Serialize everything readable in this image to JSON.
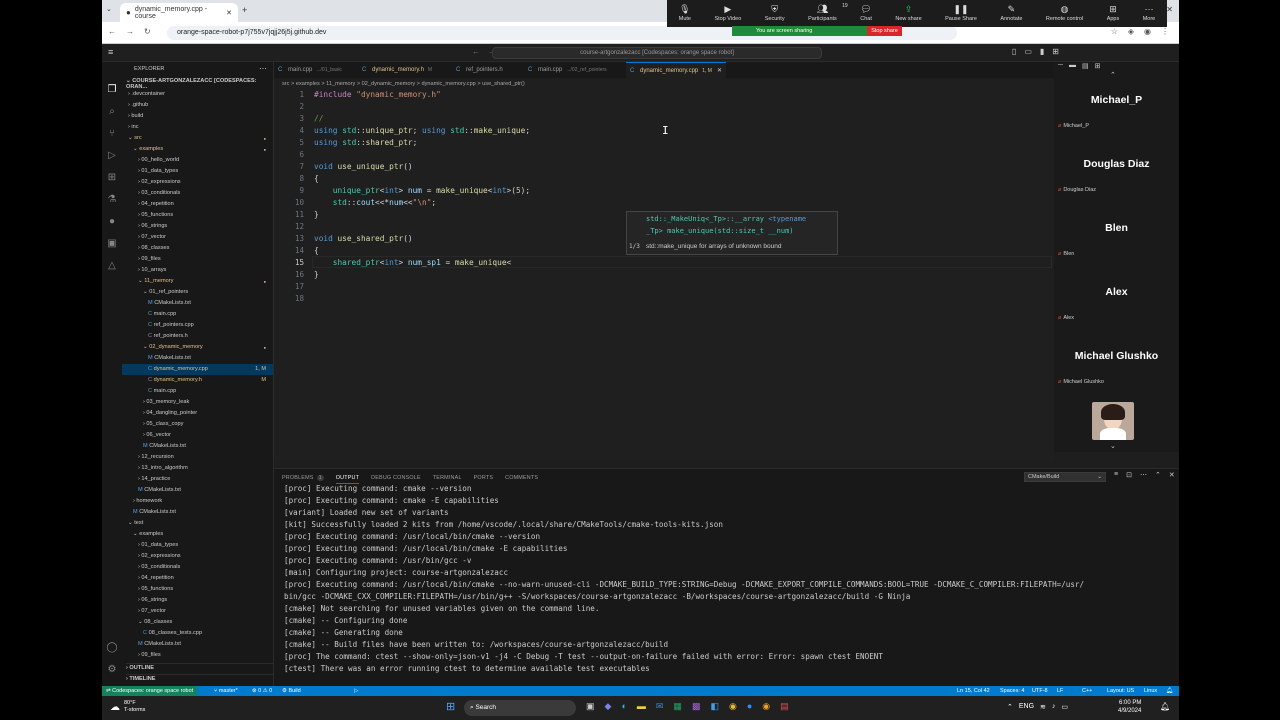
{
  "browser": {
    "tab_title": "dynamic_memory.cpp - course",
    "url": "orange-space-robot-p7j755v7jqjj26j5j.github.dev"
  },
  "zoom": {
    "buttons": [
      {
        "label": "Mute",
        "icon": "microphone-icon"
      },
      {
        "label": "Stop Video",
        "icon": "video-icon"
      },
      {
        "label": "Security",
        "icon": "shield-icon"
      },
      {
        "label": "Participants",
        "icon": "people-icon"
      },
      {
        "label": "Chat",
        "icon": "chat-icon"
      },
      {
        "label": "New share",
        "icon": "share-icon"
      },
      {
        "label": "Pause Share",
        "icon": "pause-icon"
      },
      {
        "label": "Annotate",
        "icon": "pen-icon"
      },
      {
        "label": "Remote control",
        "icon": "mouse-icon"
      },
      {
        "label": "Apps",
        "icon": "apps-icon"
      },
      {
        "label": "More",
        "icon": "more-icon"
      }
    ],
    "participants_count": "19",
    "sharing_text": "You are screen sharing",
    "stop_share": "Stop share"
  },
  "vscode": {
    "command_center": "course-artgonzalezacc [Codespaces: orange space robot]",
    "explorer_title": "EXPLORER",
    "workspace": "COURSE-ARTGONZALEZACC [CODESPACES: ORAN...",
    "tree": [
      {
        "label": ".devcontainer",
        "indent": 0,
        "kind": "folder"
      },
      {
        "label": ".github",
        "indent": 0,
        "kind": "folder"
      },
      {
        "label": "build",
        "indent": 0,
        "kind": "folder"
      },
      {
        "label": "inc",
        "indent": 0,
        "kind": "folder"
      },
      {
        "label": "src",
        "indent": 0,
        "kind": "folder-open",
        "mod": true
      },
      {
        "label": "examples",
        "indent": 1,
        "kind": "folder-open",
        "mod": true
      },
      {
        "label": "00_hello_world",
        "indent": 2,
        "kind": "folder"
      },
      {
        "label": "01_data_types",
        "indent": 2,
        "kind": "folder"
      },
      {
        "label": "02_expressions",
        "indent": 2,
        "kind": "folder"
      },
      {
        "label": "03_conditionals",
        "indent": 2,
        "kind": "folder"
      },
      {
        "label": "04_repetition",
        "indent": 2,
        "kind": "folder"
      },
      {
        "label": "05_functions",
        "indent": 2,
        "kind": "folder"
      },
      {
        "label": "06_strings",
        "indent": 2,
        "kind": "folder"
      },
      {
        "label": "07_vector",
        "indent": 2,
        "kind": "folder"
      },
      {
        "label": "08_classes",
        "indent": 2,
        "kind": "folder"
      },
      {
        "label": "09_files",
        "indent": 2,
        "kind": "folder"
      },
      {
        "label": "10_arrays",
        "indent": 2,
        "kind": "folder"
      },
      {
        "label": "11_memory",
        "indent": 2,
        "kind": "folder-open",
        "mod": true
      },
      {
        "label": "01_ref_pointers",
        "indent": 3,
        "kind": "folder-open"
      },
      {
        "label": "CMakeLists.txt",
        "indent": 4,
        "kind": "cmake"
      },
      {
        "label": "main.cpp",
        "indent": 4,
        "kind": "cpp"
      },
      {
        "label": "ref_pointers.cpp",
        "indent": 4,
        "kind": "cpp"
      },
      {
        "label": "ref_pointers.h",
        "indent": 4,
        "kind": "h"
      },
      {
        "label": "02_dynamic_memory",
        "indent": 3,
        "kind": "folder-open",
        "mod": true
      },
      {
        "label": "CMakeLists.txt",
        "indent": 4,
        "kind": "cmake"
      },
      {
        "label": "dynamic_memory.cpp",
        "indent": 4,
        "kind": "cpp",
        "selected": true,
        "badge": "1, M"
      },
      {
        "label": "dynamic_memory.h",
        "indent": 4,
        "kind": "h",
        "badge": "M"
      },
      {
        "label": "main.cpp",
        "indent": 4,
        "kind": "cpp"
      },
      {
        "label": "03_memory_leak",
        "indent": 3,
        "kind": "folder"
      },
      {
        "label": "04_dangling_pointer",
        "indent": 3,
        "kind": "folder"
      },
      {
        "label": "05_class_copy",
        "indent": 3,
        "kind": "folder"
      },
      {
        "label": "06_vector",
        "indent": 3,
        "kind": "folder"
      },
      {
        "label": "CMakeLists.txt",
        "indent": 3,
        "kind": "cmake"
      },
      {
        "label": "12_recursion",
        "indent": 2,
        "kind": "folder"
      },
      {
        "label": "13_intro_algorithm",
        "indent": 2,
        "kind": "folder"
      },
      {
        "label": "14_practice",
        "indent": 2,
        "kind": "folder"
      },
      {
        "label": "CMakeLists.txt",
        "indent": 2,
        "kind": "cmake"
      },
      {
        "label": "homework",
        "indent": 1,
        "kind": "folder"
      },
      {
        "label": "CMakeLists.txt",
        "indent": 1,
        "kind": "cmake"
      },
      {
        "label": "test",
        "indent": 0,
        "kind": "folder-open"
      },
      {
        "label": "examples",
        "indent": 1,
        "kind": "folder-open"
      },
      {
        "label": "01_data_types",
        "indent": 2,
        "kind": "folder"
      },
      {
        "label": "02_expressions",
        "indent": 2,
        "kind": "folder"
      },
      {
        "label": "03_conditionals",
        "indent": 2,
        "kind": "folder"
      },
      {
        "label": "04_repetition",
        "indent": 2,
        "kind": "folder"
      },
      {
        "label": "05_functions",
        "indent": 2,
        "kind": "folder"
      },
      {
        "label": "06_strings",
        "indent": 2,
        "kind": "folder"
      },
      {
        "label": "07_vector",
        "indent": 2,
        "kind": "folder"
      },
      {
        "label": "08_classes",
        "indent": 2,
        "kind": "folder-open"
      },
      {
        "label": "08_classes_tests.cpp",
        "indent": 3,
        "kind": "cpp"
      },
      {
        "label": "CMakeLists.txt",
        "indent": 2,
        "kind": "cmake"
      },
      {
        "label": "09_files",
        "indent": 2,
        "kind": "folder"
      }
    ],
    "outline": "OUTLINE",
    "timeline": "TIMELINE",
    "tabs": [
      {
        "label": "main.cpp",
        "hint": ".../01_basic"
      },
      {
        "label": "dynamic_memory.h",
        "hint": "M"
      },
      {
        "label": "ref_pointers.h",
        "hint": ""
      },
      {
        "label": "main.cpp",
        "hint": ".../02_ref_pointers"
      },
      {
        "label": "dynamic_memory.cpp",
        "hint": "1, M",
        "active": true
      }
    ],
    "breadcrumb": "src > examples > 11_memory > 02_dynamic_memory > dynamic_memory.cpp > use_shared_ptr()",
    "code_lines": [
      "1",
      "2",
      "3",
      "4",
      "5",
      "6",
      "7",
      "8",
      "9",
      "10",
      "11",
      "12",
      "13",
      "14",
      "15",
      "16",
      "17",
      "18"
    ],
    "signature": {
      "line1a": "std::_MakeUniq<_Tp>::__array ",
      "line1b": "<typename",
      "line2": "_Tp> make_unique(std::size_t __num)",
      "counter": "1/3",
      "desc": "std::make_unique for arrays of unknown bound"
    },
    "panel_tabs": [
      "PROBLEMS",
      "OUTPUT",
      "DEBUG CONSOLE",
      "TERMINAL",
      "PORTS",
      "COMMENTS"
    ],
    "problems_count": "1",
    "output_channel": "CMake/Build",
    "output_lines": [
      "[proc] Executing command: cmake --version",
      "[proc] Executing command: cmake -E capabilities",
      "[variant] Loaded new set of variants",
      "[kit] Successfully loaded 2 kits from /home/vscode/.local/share/CMakeTools/cmake-tools-kits.json",
      "[proc] Executing command: /usr/local/bin/cmake --version",
      "[proc] Executing command: /usr/local/bin/cmake -E capabilities",
      "[proc] Executing command: /usr/bin/gcc -v",
      "[main] Configuring project: course-artgonzalezacc",
      "[proc] Executing command: /usr/local/bin/cmake --no-warn-unused-cli -DCMAKE_BUILD_TYPE:STRING=Debug -DCMAKE_EXPORT_COMPILE_COMMANDS:BOOL=TRUE -DCMAKE_C_COMPILER:FILEPATH=/usr/",
      "bin/gcc -DCMAKE_CXX_COMPILER:FILEPATH=/usr/bin/g++ -S/workspaces/course-artgonzalezacc -B/workspaces/course-artgonzalezacc/build -G Ninja",
      "[cmake] Not searching for unused variables given on the command line.",
      "[cmake] -- Configuring done",
      "[cmake] -- Generating done",
      "[cmake] -- Build files have been written to: /workspaces/course-artgonzalezacc/build",
      "[proc] The command: ctest --show-only=json-v1 -j4 -C Debug -T test --output-on-failure failed with error: Error: spawn ctest ENOENT",
      "[ctest] There was an error running ctest to determine available test executables"
    ],
    "status": {
      "remote": "Codespaces: orange space robot",
      "branch": "master*",
      "errors": "⊗ 0 ⚠ 0",
      "build": "Build",
      "position": "Ln 15, Col 42",
      "spaces": "Spaces: 4",
      "encoding": "UTF-8",
      "eol": "LF",
      "lang": "C++",
      "layout": "Layout: US",
      "os": "Linux"
    }
  },
  "participants": [
    {
      "name": "Michael_P",
      "sub": "Michael_P"
    },
    {
      "name": "Douglas Diaz",
      "sub": "Douglas Diaz"
    },
    {
      "name": "Blen",
      "sub": "Blen"
    },
    {
      "name": "Alex",
      "sub": "Alex"
    },
    {
      "name": "Michael Glushko",
      "sub": "Michael Glushko"
    }
  ],
  "taskbar": {
    "weather_temp": "80°F",
    "weather_desc": "T-storms",
    "search": "Search",
    "lang": "ENG",
    "time": "6:00 PM",
    "date": "4/9/2024"
  }
}
